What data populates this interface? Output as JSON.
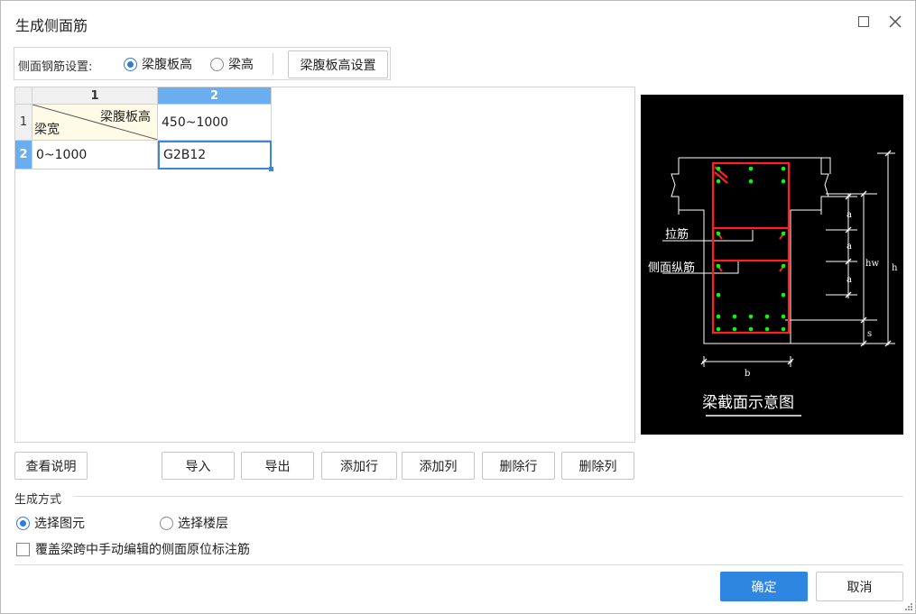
{
  "dialog": {
    "title": "生成侧面筋"
  },
  "settings": {
    "label": "侧面钢筋设置:",
    "options": [
      {
        "label": "梁腹板高",
        "selected": true
      },
      {
        "label": "梁高",
        "selected": false
      }
    ],
    "fuban_button": "梁腹板高设置"
  },
  "grid": {
    "columns": [
      "1",
      "2"
    ],
    "selected_column": "2",
    "rows": [
      {
        "row_header": "1",
        "col1_top": "梁腹板高",
        "col1_bottom": "梁宽",
        "col2": "450~1000"
      },
      {
        "row_header": "2",
        "col1": "0~1000",
        "col2": "G2B12"
      }
    ],
    "selected_row": "2"
  },
  "diagram": {
    "caption": "梁截面示意图",
    "labels": {
      "tie": "拉筋",
      "side_bar": "侧面纵筋",
      "a": "a",
      "hw": "hw",
      "h": "h",
      "s": "s",
      "b": "b"
    }
  },
  "toolbar": {
    "help": "查看说明",
    "import": "导入",
    "export": "导出",
    "add_row": "添加行",
    "add_col": "添加列",
    "del_row": "删除行",
    "del_col": "删除列"
  },
  "mode": {
    "title": "生成方式",
    "options": [
      {
        "label": "选择图元",
        "selected": true
      },
      {
        "label": "选择楼层",
        "selected": false
      }
    ],
    "override_checkbox": {
      "label": "覆盖梁跨中手动编辑的侧面原位标注筋",
      "checked": false
    }
  },
  "footer": {
    "ok": "确定",
    "cancel": "取消"
  },
  "colors": {
    "accent": "#2f86e0",
    "header_selected": "#6aaef0",
    "rebar_red": "#ff2020",
    "rebar_green": "#00ff00"
  }
}
